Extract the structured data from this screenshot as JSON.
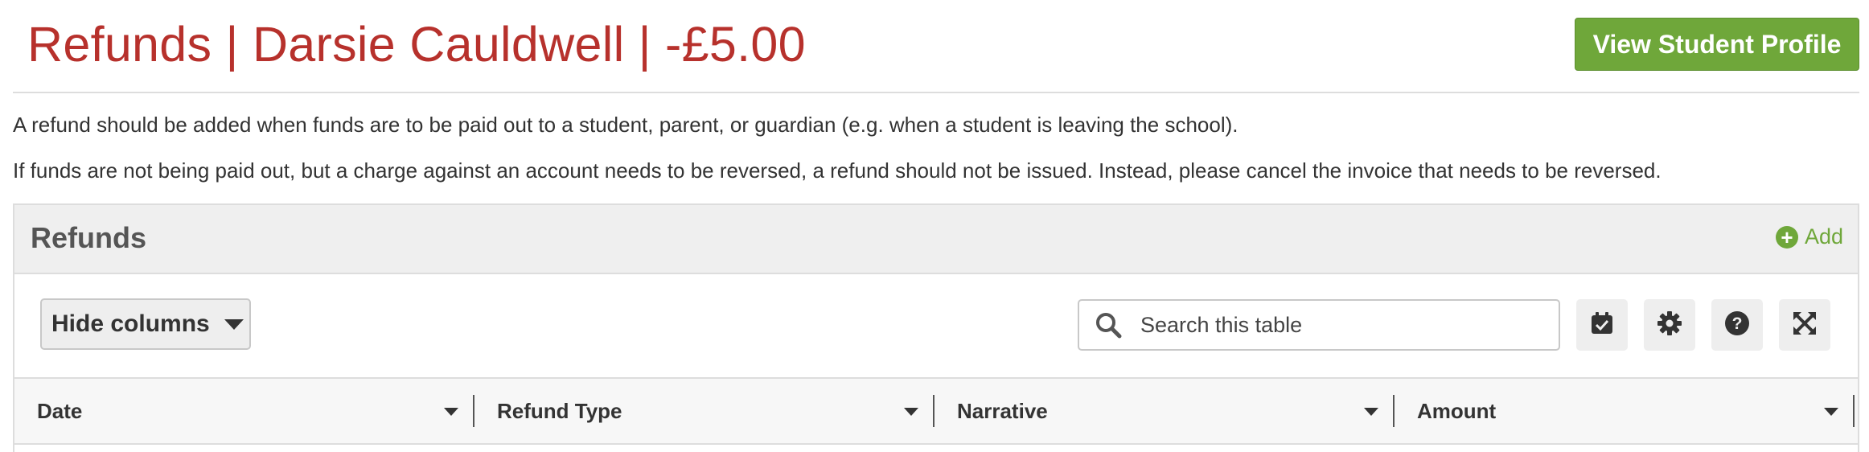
{
  "header": {
    "title": "Refunds | Darsie Cauldwell | -£5.00",
    "view_profile_label": "View Student Profile"
  },
  "info": {
    "line1": "A refund should be added when funds are to be paid out to a student, parent, or guardian (e.g. when a student is leaving the school).",
    "line2": "If funds are not being paid out, but a charge against an account needs to be reversed, a refund should not be issued. Instead, please cancel the invoice that needs to be reversed."
  },
  "panel": {
    "title": "Refunds",
    "add_label": "Add"
  },
  "toolbar": {
    "hide_columns_label": "Hide columns",
    "search_placeholder": "Search this table",
    "search_value": "",
    "buttons": [
      "calendar-check-icon",
      "gear-icon",
      "help-icon",
      "expand-icon"
    ]
  },
  "table": {
    "columns": [
      "Date",
      "Refund Type",
      "Narrative",
      "Amount"
    ]
  },
  "colors": {
    "title": "#b7312c",
    "primary_button": "#6fa73a",
    "add_link": "#6fa73a"
  }
}
